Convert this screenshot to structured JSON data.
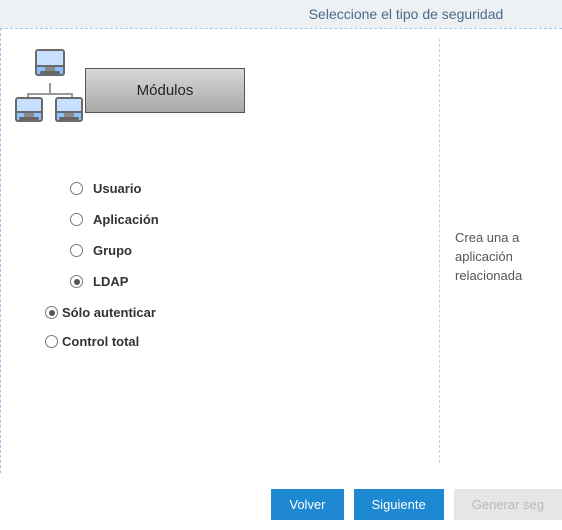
{
  "header": {
    "title": "Seleccione el tipo de seguridad"
  },
  "module": {
    "label": "Módulos",
    "icon": "network-computers-icon"
  },
  "security_types": [
    {
      "key": "usuario",
      "label": "Usuario",
      "selected": false
    },
    {
      "key": "aplicacion",
      "label": "Aplicación",
      "selected": false
    },
    {
      "key": "grupo",
      "label": "Grupo",
      "selected": false
    },
    {
      "key": "ldap",
      "label": "LDAP",
      "selected": true
    }
  ],
  "ldap_modes": [
    {
      "key": "solo_autenticar",
      "label": "Sólo autenticar",
      "selected": true
    },
    {
      "key": "control_total",
      "label": "Control total",
      "selected": false
    }
  ],
  "description": {
    "line1": "Crea una a",
    "line2": "aplicación ",
    "line3": "relacionada"
  },
  "footer": {
    "back": "Volver",
    "next": "Siguiente",
    "generate": "Generar seg"
  }
}
